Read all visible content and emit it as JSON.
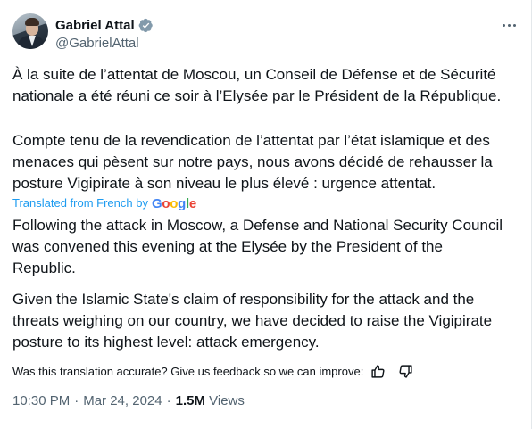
{
  "author": {
    "name": "Gabriel Attal",
    "handle": "@GabrielAttal"
  },
  "tweet": {
    "original_paragraphs": [
      "À la suite de l’attentat de Moscou, un Conseil de Défense et de Sécurité\nnationale a été réuni ce soir à l’Elysée par le Président de la République.",
      "Compte tenu de la revendication de l’attentat par l’état islamique et des\nmenaces qui pèsent sur notre pays, nous avons décidé de rehausser la\nposture Vigipirate à son niveau le plus élevé : urgence attentat."
    ],
    "translated_label": "Translated from French by",
    "translator_brand": "Google",
    "translated_paragraphs": [
      "Following the attack in Moscow, a Defense and National Security Council\nwas convened this evening at the Elysée by the President of the\nRepublic.",
      "Given the Islamic State's claim of responsibility for the attack and the\nthreats weighing on our country, we have decided to raise the Vigipirate\nposture to its highest level: attack emergency."
    ],
    "feedback_prompt": "Was this translation accurate? Give us feedback so we can improve:",
    "time": "10:30 PM",
    "date": "Mar 24, 2024",
    "separator": "·",
    "views_count": "1.5M",
    "views_label": "Views"
  },
  "icons": {
    "verified": "verified-badge-icon",
    "more": "more-options-icon",
    "thumbs_up": "thumbs-up-icon",
    "thumbs_down": "thumbs-down-icon"
  },
  "colors": {
    "accent": "#1d9bf0",
    "text": "#0f1419",
    "secondary": "#536471"
  }
}
